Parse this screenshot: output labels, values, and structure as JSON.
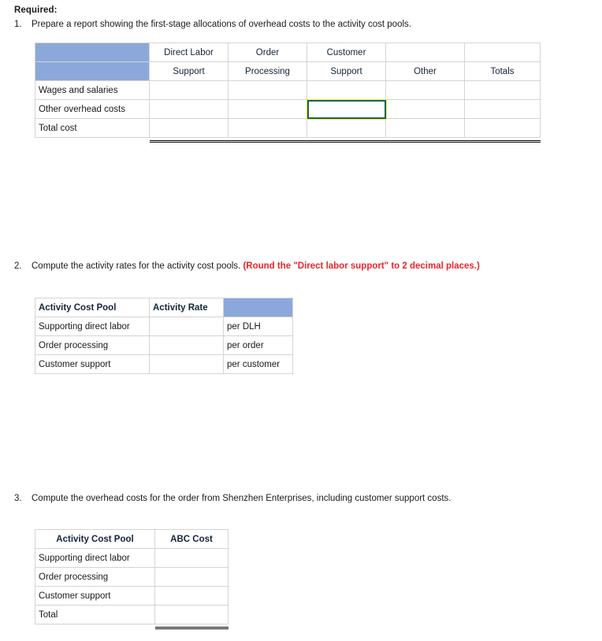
{
  "meta": {
    "header_blue": "#8ca8da",
    "input_border_yellow": "#f5e534",
    "focus_border": "#16645f",
    "red_accent": "#e8252c"
  },
  "required_label": "Required:",
  "questions": [
    {
      "number": "1.",
      "text": "Prepare a report showing the first-stage allocations of overhead costs to the activity cost pools."
    },
    {
      "number": "2.",
      "text": "Compute the activity rates for the activity cost pools. ",
      "note": "(Round the \"Direct labor support\" to 2 decimal places.)"
    },
    {
      "number": "3.",
      "text": "Compute the overhead costs for the order from Shenzhen Enterprises, including customer support costs."
    }
  ],
  "table1": {
    "header_row_1": [
      "",
      "Direct Labor",
      "Order",
      "Customer",
      "",
      ""
    ],
    "header_row_2": [
      "",
      "Support",
      "Processing",
      "Support",
      "Other",
      "Totals"
    ],
    "rows": [
      {
        "label": "Wages and salaries",
        "values": [
          "",
          "",
          "",
          "",
          ""
        ]
      },
      {
        "label": "Other overhead costs",
        "values": [
          "",
          "",
          "",
          "",
          ""
        ]
      },
      {
        "label": "Total cost",
        "values": [
          "",
          "",
          "",
          "",
          ""
        ]
      }
    ]
  },
  "table2": {
    "headers": [
      "Activity Cost Pool",
      "Activity Rate",
      ""
    ],
    "rows": [
      {
        "label": "Supporting direct labor",
        "value": "",
        "unit": "per DLH"
      },
      {
        "label": "Order processing",
        "value": "",
        "unit": "per order"
      },
      {
        "label": "Customer support",
        "value": "",
        "unit": "per customer"
      }
    ]
  },
  "table3": {
    "headers": [
      "Activity Cost Pool",
      "ABC Cost"
    ],
    "rows": [
      {
        "label": "Supporting direct labor",
        "value": ""
      },
      {
        "label": "Order processing",
        "value": ""
      },
      {
        "label": "Customer support",
        "value": ""
      }
    ],
    "total": {
      "label": "Total",
      "value": ""
    }
  }
}
